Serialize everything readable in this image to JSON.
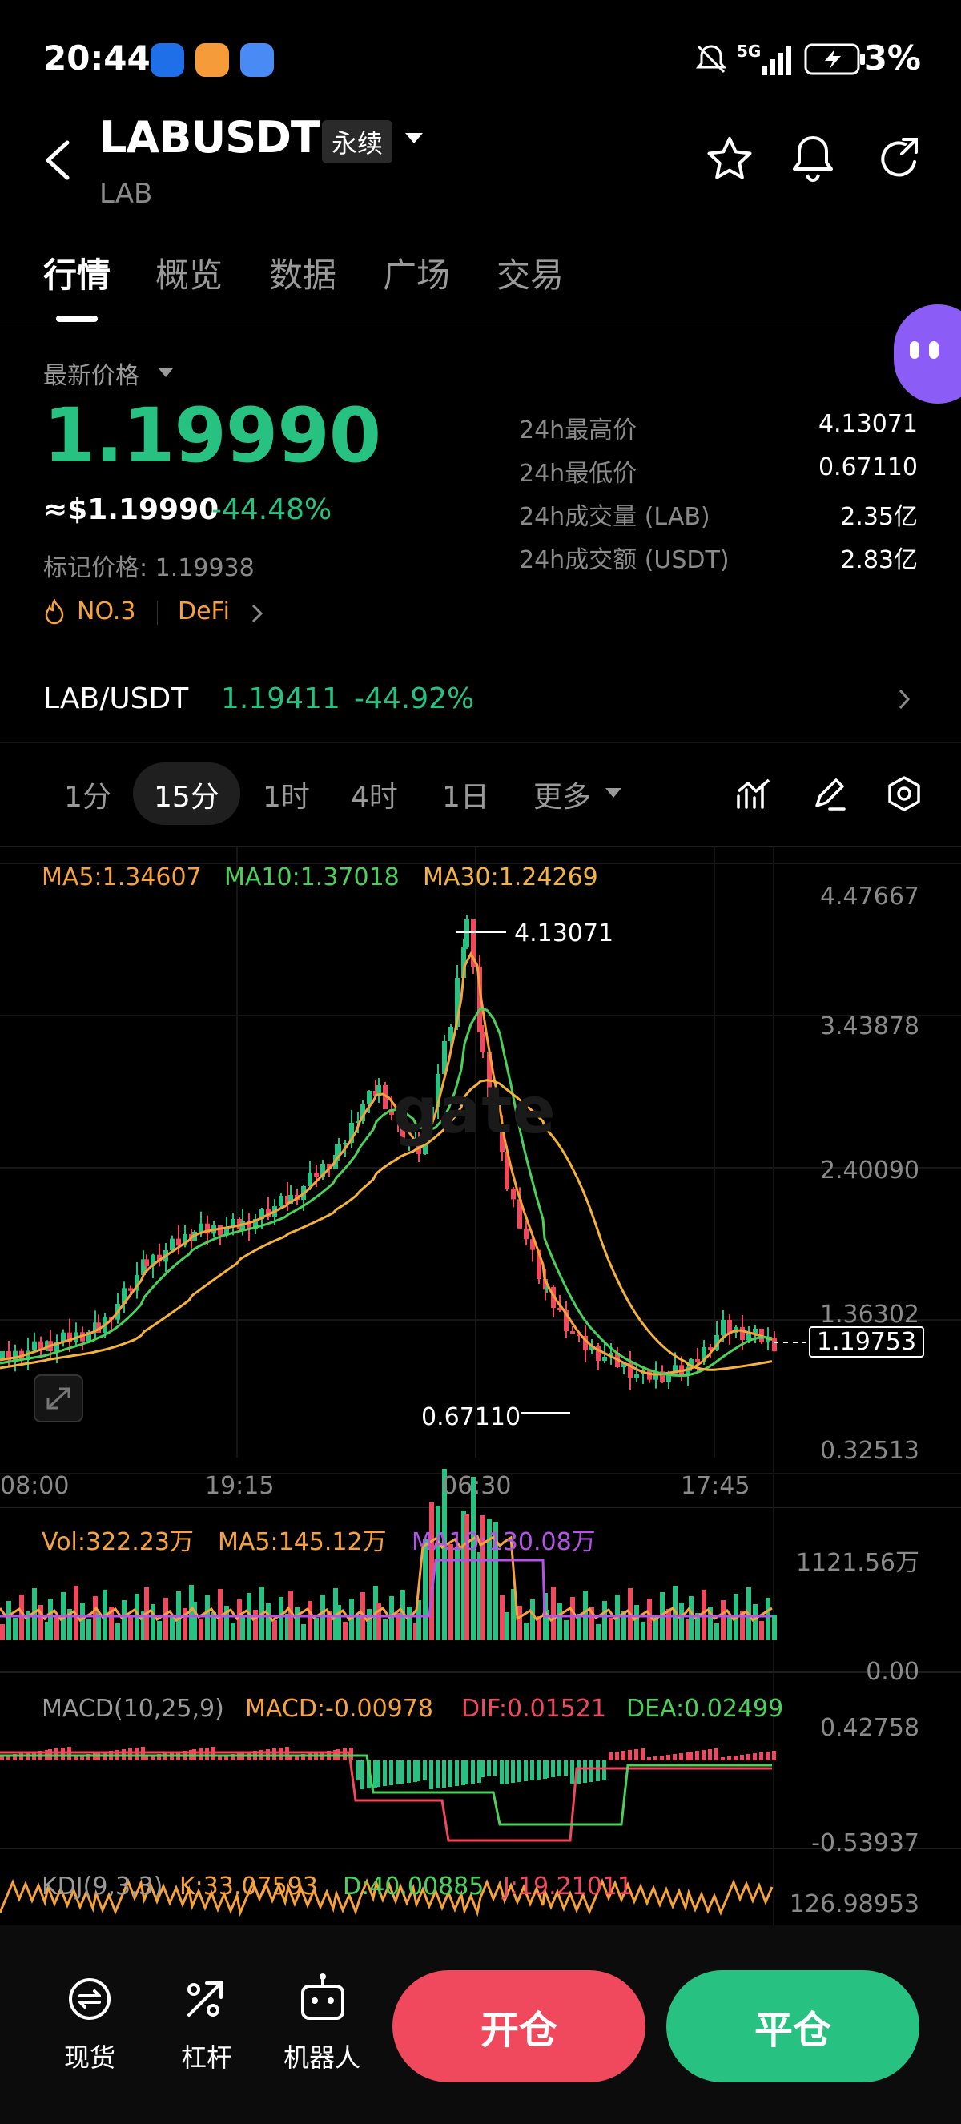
{
  "status_bar": {
    "time": "20:44",
    "battery": "3%",
    "signal": "5G"
  },
  "header": {
    "symbol": "LABUSDT",
    "contract_type": "永续",
    "base": "LAB"
  },
  "tabs": [
    "行情",
    "概览",
    "数据",
    "广场",
    "交易"
  ],
  "price": {
    "label": "最新价格",
    "last": "1.19990",
    "usd": "≈$1.19990",
    "change": "-44.48%",
    "mark_label": "标记价格: 1.19938",
    "rank_tag": "NO.3",
    "category_tag": "DeFi"
  },
  "stats": [
    {
      "label": "24h最高价",
      "value": "4.13071"
    },
    {
      "label": "24h最低价",
      "value": "0.67110"
    },
    {
      "label": "24h成交量 (LAB)",
      "value": "2.35亿"
    },
    {
      "label": "24h成交额 (USDT)",
      "value": "2.83亿"
    }
  ],
  "spot_pair": {
    "name": "LAB/USDT",
    "price": "1.19411",
    "change": "-44.92%"
  },
  "intervals": [
    "1分",
    "15分",
    "1时",
    "4时",
    "1日",
    "更多"
  ],
  "active_interval": "15分",
  "chart": {
    "ma": {
      "ma5": "MA5:1.34607",
      "ma10": "MA10:1.37018",
      "ma30": "MA30:1.24269"
    },
    "y_ticks": [
      "4.47667",
      "3.43878",
      "2.40090",
      "1.36302",
      "0.32513"
    ],
    "x_ticks": [
      "08:00",
      "19:15",
      "06:30",
      "17:45"
    ],
    "high_label": "4.13071",
    "low_label": "0.67110",
    "current_label": "1.19753",
    "watermark": "gate",
    "vol": {
      "vol": "Vol:322.23万",
      "ma5": "MA5:145.12万",
      "ma10": "MA10:130.08万",
      "max": "1121.56万",
      "min": "0.00"
    },
    "macd": {
      "title": "MACD(10,25,9)",
      "macd": "MACD:-0.00978",
      "dif": "DIF:0.01521",
      "dea": "DEA:0.02499",
      "max": "0.42758",
      "min": "-0.53937"
    },
    "kdj": {
      "title": "KDJ(9,3,3)",
      "k": "K:33.07593",
      "d": "D:40.00885",
      "j": "J:19.21011",
      "max": "126.98953"
    }
  },
  "bottom_nav": {
    "spot": "现货",
    "leverage": "杠杆",
    "bot": "机器人"
  },
  "actions": {
    "open": "开仓",
    "close": "平仓"
  },
  "colors": {
    "up": "#27c282",
    "down": "#f0485c",
    "ma5": "#f7a23b",
    "ma10": "#4bd05b",
    "ma30": "#f5b23c",
    "accent": "#8b5cf6"
  }
}
